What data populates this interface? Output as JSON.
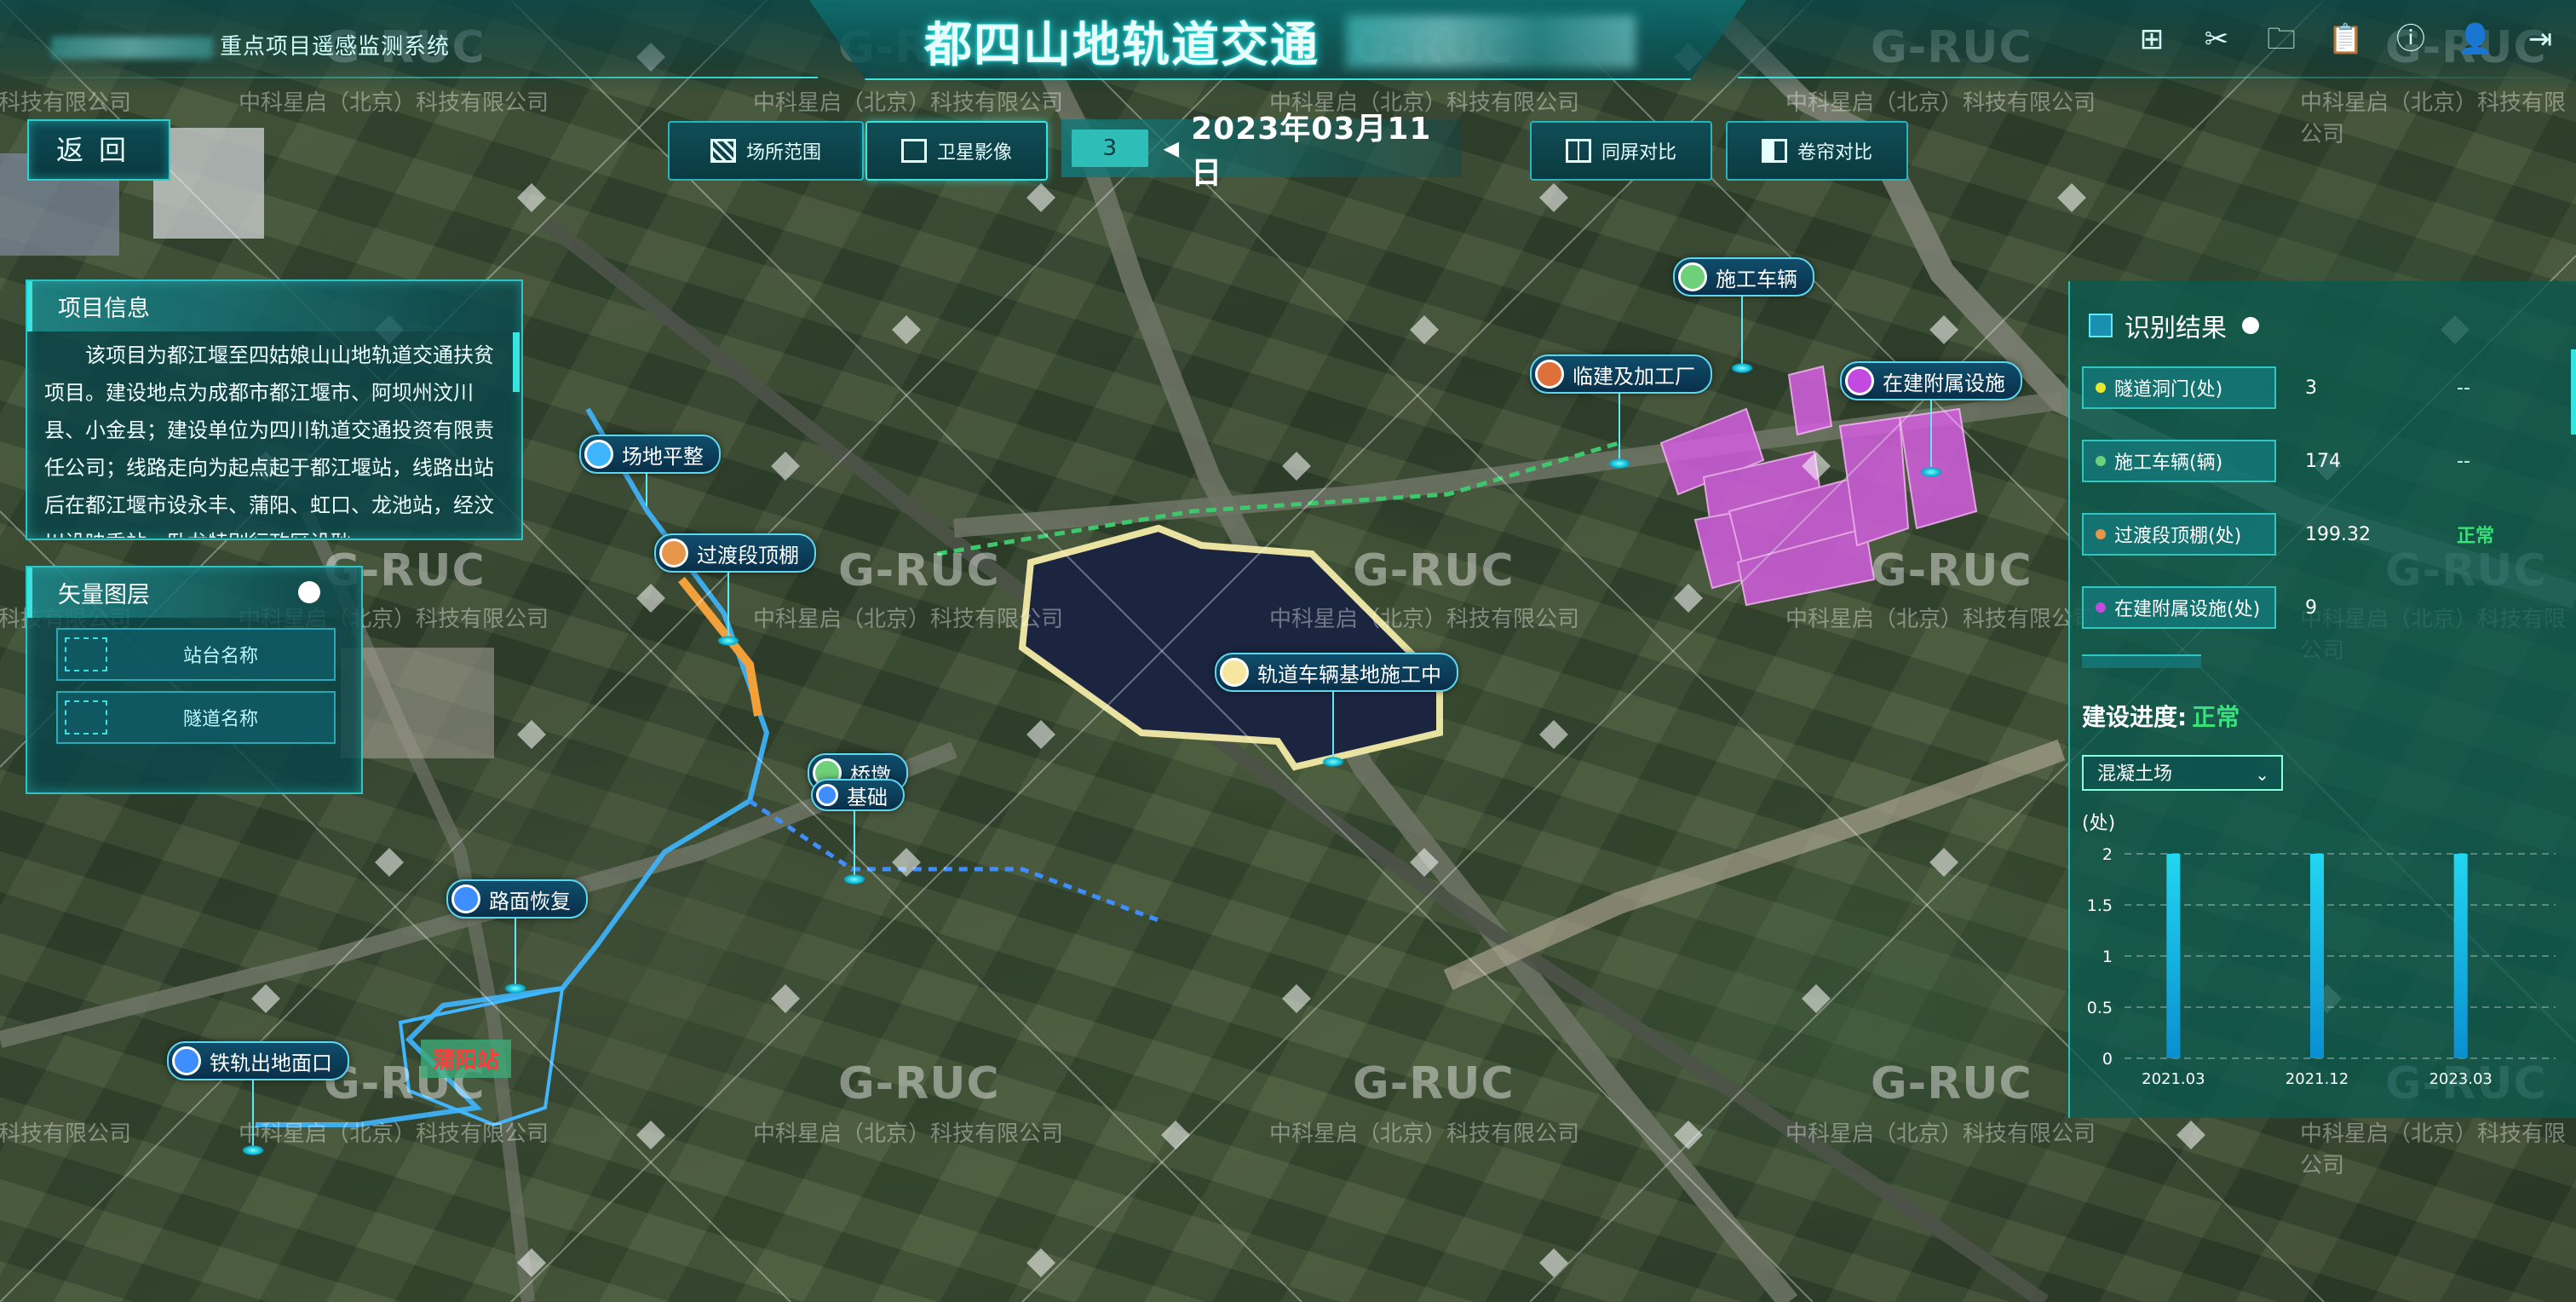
{
  "header": {
    "system_title": "重点项目遥感监测系统",
    "main_title": "都四山地轨道交通"
  },
  "top_icons": [
    {
      "name": "grid-icon",
      "glyph": "⊞"
    },
    {
      "name": "scissors-icon",
      "glyph": "✂"
    },
    {
      "name": "folder-icon",
      "glyph": "🗀"
    },
    {
      "name": "clipboard-icon",
      "glyph": "📋"
    },
    {
      "name": "info-icon",
      "glyph": "ⓘ"
    },
    {
      "name": "user-icon",
      "glyph": "👤"
    },
    {
      "name": "logout-icon",
      "glyph": "⇥"
    }
  ],
  "toolbar": {
    "back_label": "返回",
    "site_range_label": "场所范围",
    "satellite_label": "卫星影像",
    "date_index": "3",
    "date_label": "2023年03月11日",
    "split_compare_label": "同屏对比",
    "curtain_compare_label": "卷帘对比"
  },
  "project_info": {
    "title": "项目信息",
    "text": "该项目为都江堰至四姑娘山山地轨道交通扶贫项目。建设地点为成都市都江堰市、阿坝州汶川县、小金县；建设单位为四川轨道交通投资有限责任公司；线路走向为起点起于都江堰站，线路出站后在都江堰市设永丰、蒲阳、虹口、龙池站，经汶川设映秀站，卧龙特别行政区设耿"
  },
  "vector_layers": {
    "title": "矢量图层",
    "items": [
      "站台名称",
      "隧道名称"
    ]
  },
  "map_labels": [
    {
      "id": "site-leveling",
      "text": "场地平整",
      "color": "#3fb4ff"
    },
    {
      "id": "transition-canopy",
      "text": "过渡段顶棚",
      "color": "#e8964a"
    },
    {
      "id": "bridge-pier",
      "text": "桥墩",
      "color": "#6fd07a"
    },
    {
      "id": "foundation",
      "text": "基础",
      "color": "#3f8eff"
    },
    {
      "id": "road-restore",
      "text": "路面恢复",
      "color": "#3f8eff"
    },
    {
      "id": "rail-exit",
      "text": "铁轨出地面口",
      "color": "#3f8eff"
    },
    {
      "id": "depot",
      "text": "轨道车辆基地施工中",
      "color": "#f7e6a0"
    },
    {
      "id": "construction-vehicle",
      "text": "施工车辆",
      "color": "#6fd07a"
    },
    {
      "id": "temp-plant",
      "text": "临建及加工厂",
      "color": "#e0703a"
    },
    {
      "id": "aux-facility",
      "text": "在建附属设施",
      "color": "#c24ae0"
    }
  ],
  "station_label": "蒲阳站",
  "recognition": {
    "title": "识别结果",
    "rows": [
      {
        "name": "隧道洞门(处)",
        "value": "3",
        "status": "--",
        "color": "#e8e830"
      },
      {
        "name": "施工车辆(辆)",
        "value": "174",
        "status": "--",
        "color": "#6fd07a"
      },
      {
        "name": "过渡段顶棚(处)",
        "value": "199.32",
        "status": "正常",
        "color": "#e8964a"
      },
      {
        "name": "在建附属设施(处)",
        "value": "9",
        "status": "",
        "color": "#c24ae0"
      }
    ]
  },
  "progress": {
    "title": "建设进度:",
    "status": "正常",
    "dropdown_value": "混凝土场",
    "unit": "(处)"
  },
  "chart_data": {
    "type": "bar",
    "categories": [
      "2021.03",
      "2021.12",
      "2023.03"
    ],
    "values": [
      2,
      2,
      2
    ],
    "ylim": [
      0,
      2
    ],
    "yticks": [
      "0",
      "0.5",
      "1",
      "1.5",
      "2"
    ],
    "grid": true,
    "bar_color": "#22d6f0"
  },
  "watermark": {
    "brand": "G-RUC",
    "company": "中科星启（北京）科技有限公司"
  }
}
